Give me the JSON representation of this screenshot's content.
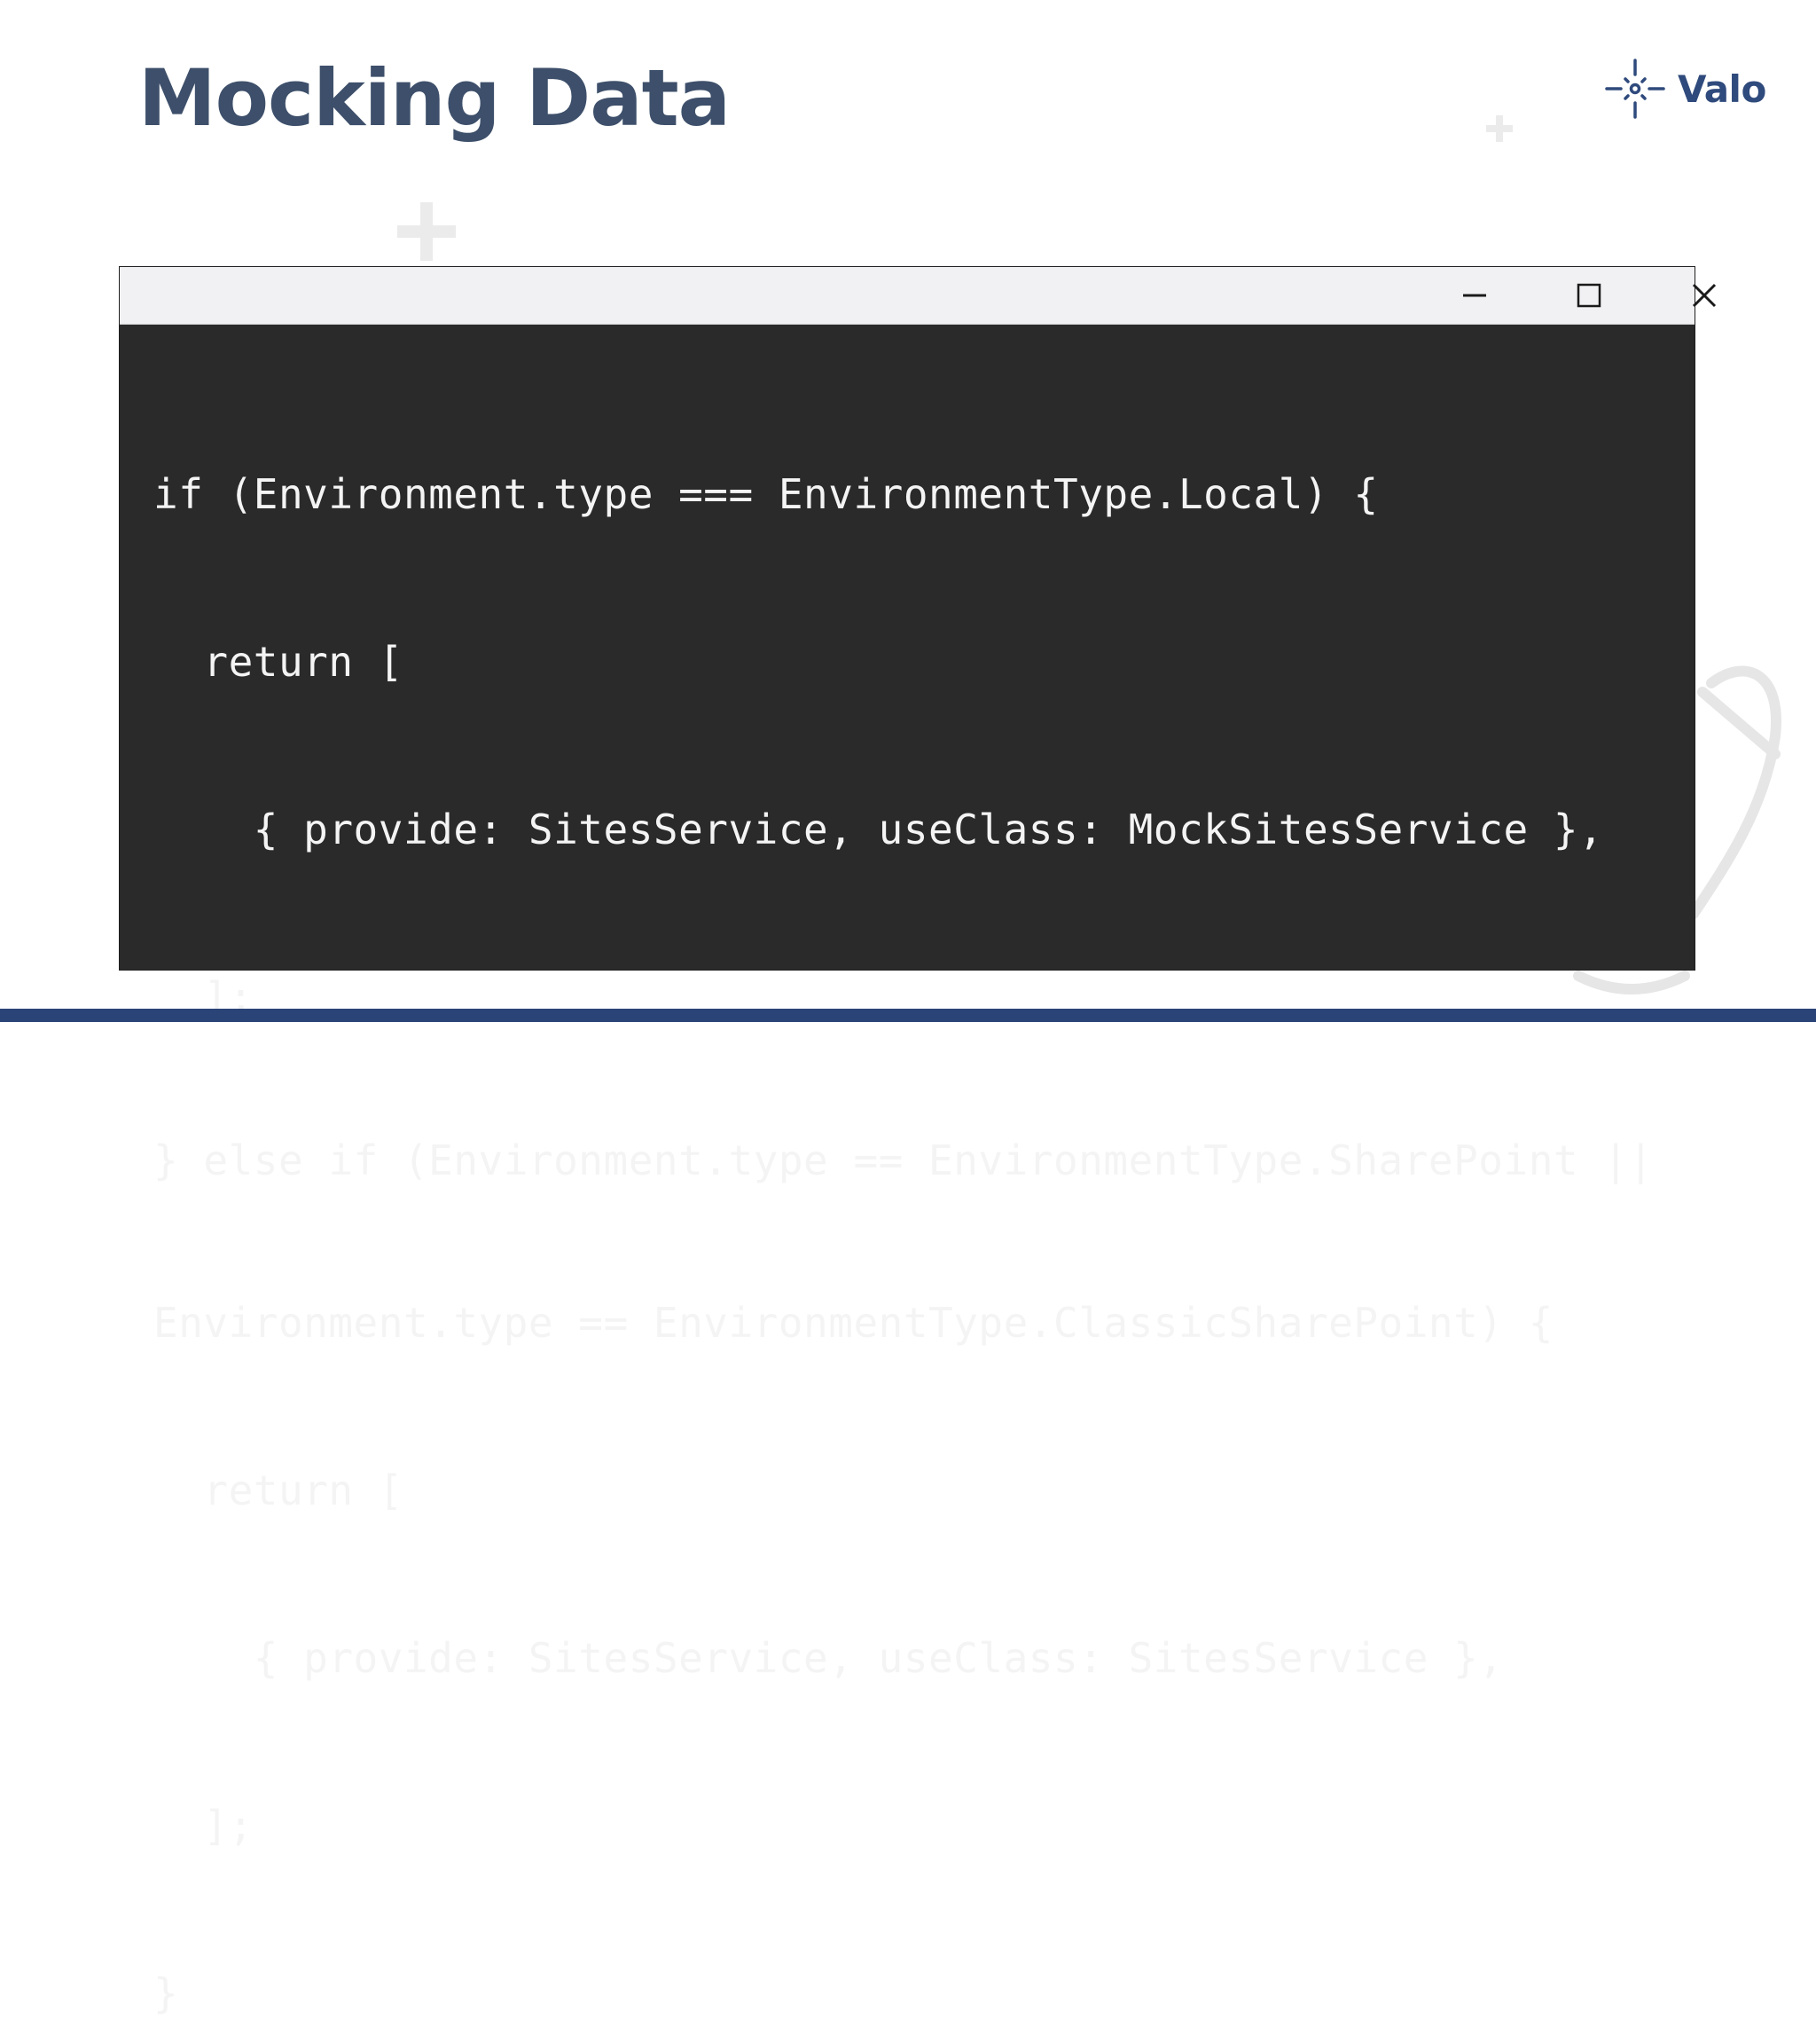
{
  "slide": {
    "title": "Mocking Data"
  },
  "logo": {
    "text": "Valo",
    "icon": "sparkle-icon",
    "brand_color": "#2f4a7c"
  },
  "window": {
    "controls": {
      "minimize_icon": "minimize-icon",
      "maximize_icon": "maximize-icon",
      "close_icon": "close-icon"
    },
    "code_lines": [
      "if (Environment.type === EnvironmentType.Local) {",
      "  return [",
      "    { provide: SitesService, useClass: MockSitesService },",
      "  ];",
      "} else if (Environment.type == EnvironmentType.SharePoint ||",
      "Environment.type == EnvironmentType.ClassicSharePoint) {",
      "  return [",
      "    { provide: SitesService, useClass: SitesService },",
      "  ];",
      "}"
    ]
  },
  "colors": {
    "title": "#3d4f6a",
    "code_background": "#2a2a2a",
    "code_text": "#f4f4f4",
    "bottom_bar": "#2a4478"
  }
}
